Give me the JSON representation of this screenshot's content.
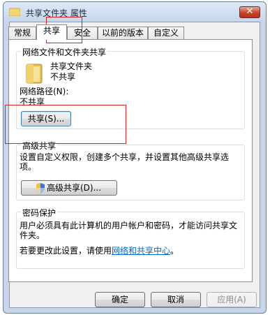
{
  "window": {
    "title": "共享文件夹 属性",
    "close_label": "✕"
  },
  "tabs": [
    {
      "label": "常规"
    },
    {
      "label": "共享"
    },
    {
      "label": "安全"
    },
    {
      "label": "以前的版本"
    },
    {
      "label": "自定义"
    }
  ],
  "network_sharing": {
    "group_title": "网络文件和文件夹共享",
    "folder_name": "共享文件夹",
    "folder_status": "不共享",
    "network_path_label": "网络路径(N):",
    "network_path_value": "不共享",
    "share_button": "共享(S)..."
  },
  "advanced_sharing": {
    "group_title": "高级共享",
    "description": "设置自定义权限，创建多个共享，并设置其他高级共享选项。",
    "button": "高级共享(D)..."
  },
  "password_protection": {
    "group_title": "密码保护",
    "description": "用户必须具有此计算机的用户帐户和密码，才能访问共享文件夹。",
    "change_prefix": "若要更改此设置，请使用",
    "link": "网络和共享中心",
    "change_suffix": "。"
  },
  "footer": {
    "ok": "确定",
    "cancel": "取消",
    "apply": "应用(A)"
  },
  "colors": {
    "highlight": "#e02020",
    "link": "#0066cc"
  }
}
